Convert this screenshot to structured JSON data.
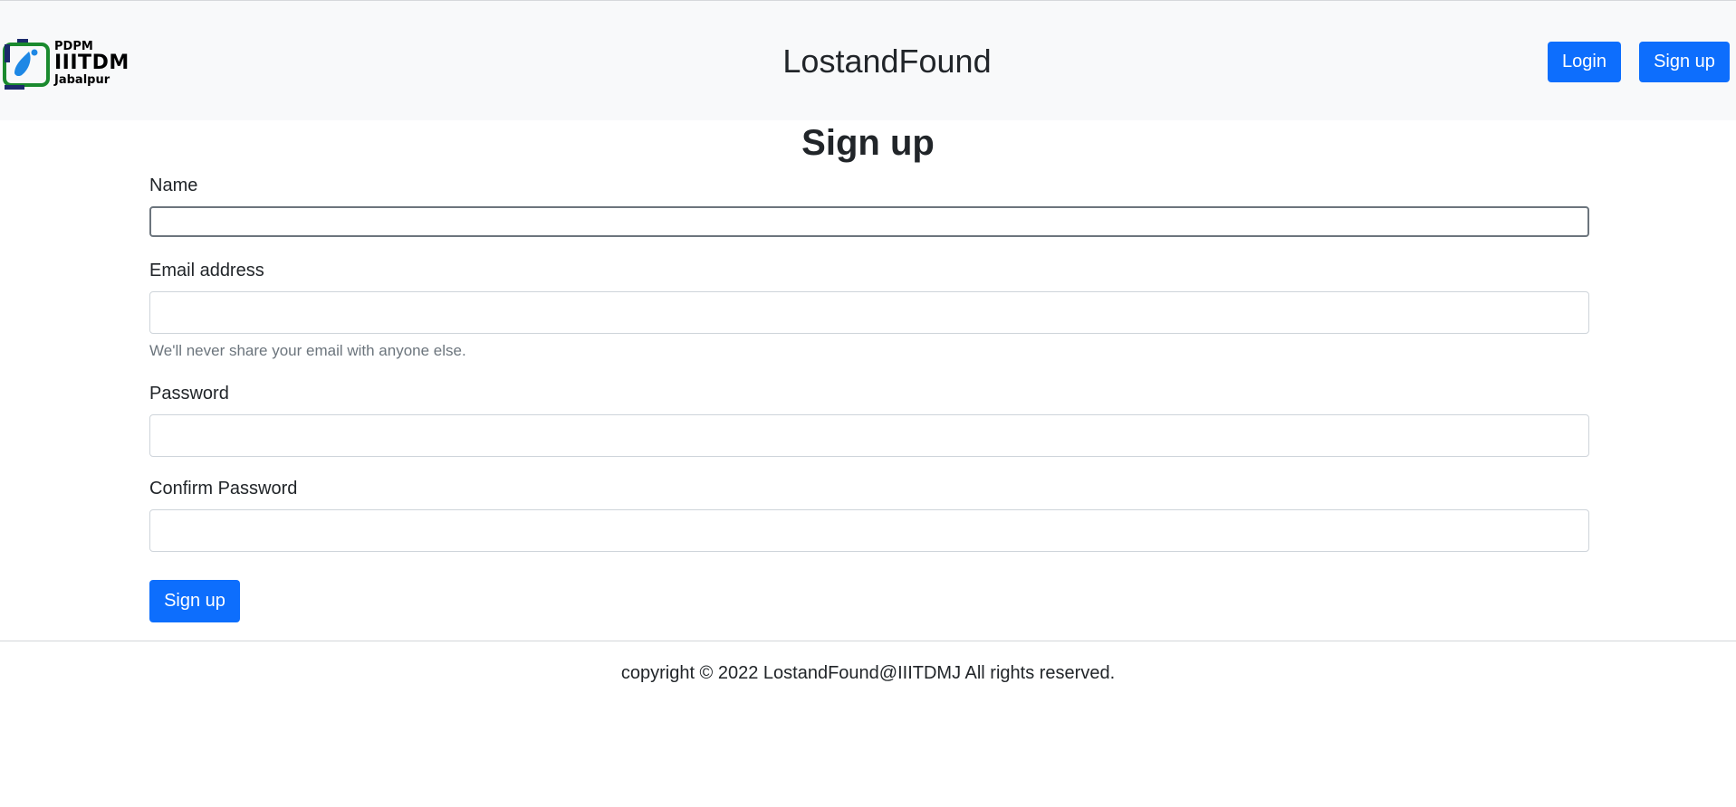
{
  "header": {
    "logo": {
      "line1": "PDPM",
      "line2": "IIITDM",
      "line3": "Jabalpur"
    },
    "site_title": "LostandFound",
    "login_label": "Login",
    "signup_label": "Sign up"
  },
  "page": {
    "heading": "Sign up"
  },
  "form": {
    "name_label": "Name",
    "name_value": "",
    "email_label": "Email address",
    "email_value": "",
    "email_help": "We'll never share your email with anyone else.",
    "password_label": "Password",
    "password_value": "",
    "confirm_label": "Confirm Password",
    "confirm_value": "",
    "submit_label": "Sign up"
  },
  "footer": {
    "text": "copyright © 2022 LostandFound@IIITDMJ All rights reserved."
  },
  "colors": {
    "primary": "#0d6efd",
    "navbar_bg": "#f8f9fa",
    "logo_green": "#1a8a2e",
    "logo_navy": "#1b2a6b",
    "logo_blue": "#1e88e5"
  }
}
